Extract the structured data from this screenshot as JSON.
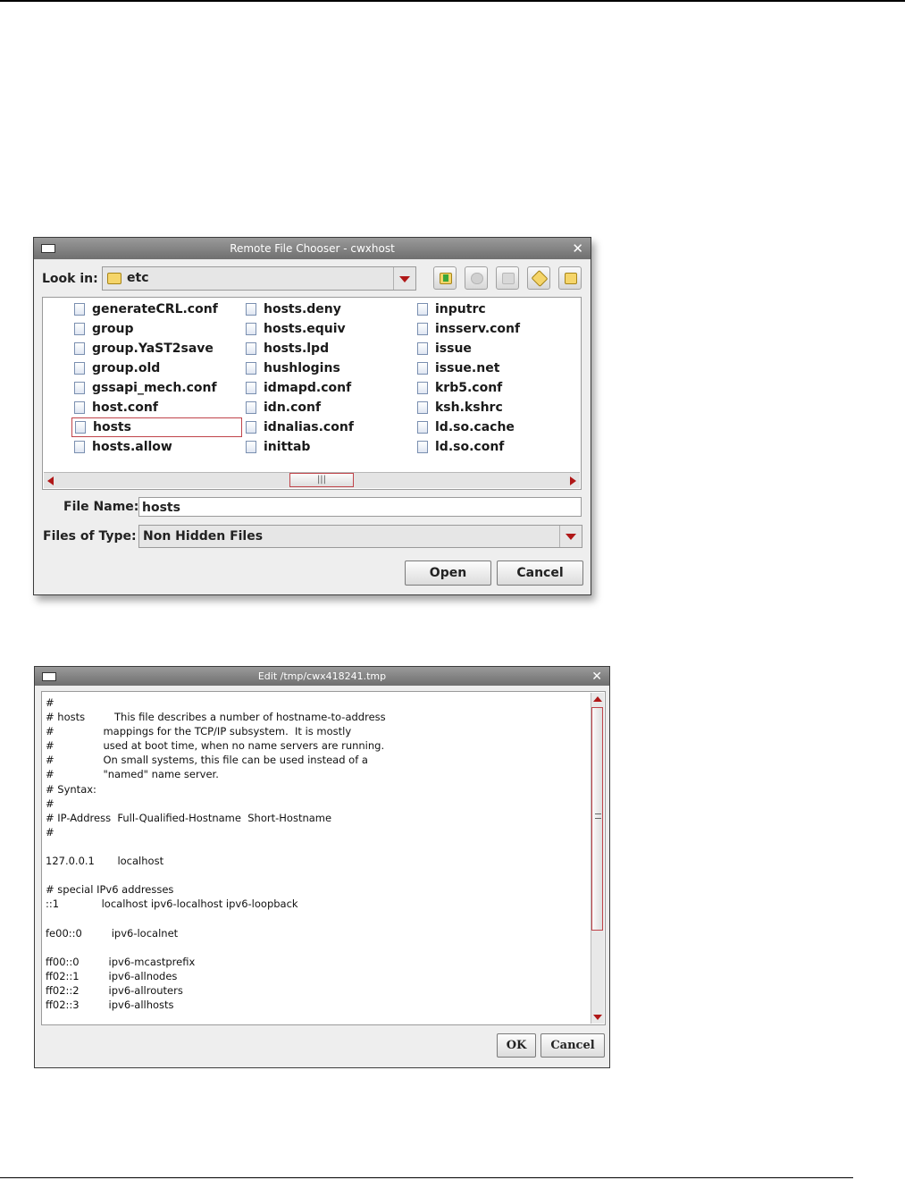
{
  "chooser": {
    "title": "Remote File Chooser - cwxhost",
    "look_in_label": "Look in:",
    "look_in_value": "etc",
    "toolbar_icons": [
      "up-folder-icon",
      "home-icon",
      "new-folder-icon",
      "list-view-icon",
      "details-view-icon"
    ],
    "files": [
      "generateCRL.conf",
      "group",
      "group.YaST2save",
      "group.old",
      "gssapi_mech.conf",
      "host.conf",
      "hosts",
      "hosts.allow",
      "hosts.deny",
      "hosts.equiv",
      "hosts.lpd",
      "hushlogins",
      "idmapd.conf",
      "idn.conf",
      "idnalias.conf",
      "inittab",
      "inputrc",
      "insserv.conf",
      "issue",
      "issue.net",
      "krb5.conf",
      "ksh.kshrc",
      "ld.so.cache",
      "ld.so.conf"
    ],
    "selected_file": "hosts",
    "file_name_label": "File Name:",
    "file_name_value": "hosts",
    "files_of_type_label": "Files of Type:",
    "files_of_type_value": "Non Hidden Files",
    "open_label": "Open",
    "cancel_label": "Cancel"
  },
  "editor": {
    "title": "Edit /tmp/cwx418241.tmp",
    "lines": [
      "#",
      "# hosts         This file describes a number of hostname-to-address",
      "#               mappings for the TCP/IP subsystem.  It is mostly",
      "#               used at boot time, when no name servers are running.",
      "#               On small systems, this file can be used instead of a",
      "#               \"named\" name server.",
      "# Syntax:",
      "#",
      "# IP-Address  Full-Qualified-Hostname  Short-Hostname",
      "#",
      "",
      "127.0.0.1       localhost",
      "",
      "# special IPv6 addresses",
      "::1             localhost ipv6-localhost ipv6-loopback",
      "",
      "fe00::0         ipv6-localnet",
      "",
      "ff00::0         ipv6-mcastprefix",
      "ff02::1         ipv6-allnodes",
      "ff02::2         ipv6-allrouters",
      "ff02::3         ipv6-allhosts"
    ],
    "ok_label": "OK",
    "cancel_label": "Cancel"
  }
}
